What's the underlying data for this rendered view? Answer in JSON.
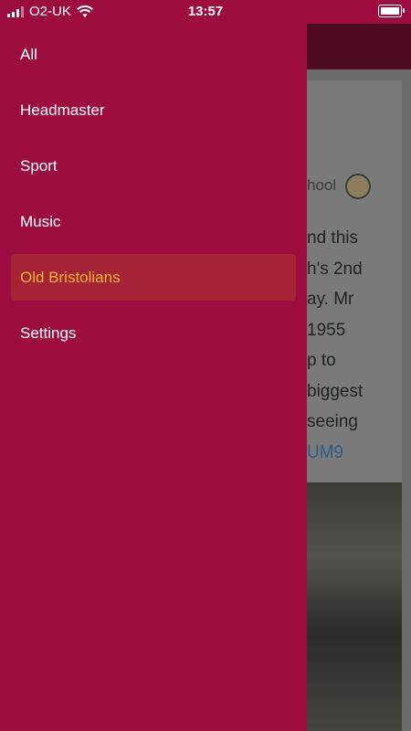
{
  "status_bar": {
    "carrier": "O2-UK",
    "time": "13:57"
  },
  "drawer": {
    "items": [
      {
        "label": "All",
        "active": false
      },
      {
        "label": "Headmaster",
        "active": false
      },
      {
        "label": "Sport",
        "active": false
      },
      {
        "label": "Music",
        "active": false
      },
      {
        "label": "Old Bristolians",
        "active": true
      },
      {
        "label": "Settings",
        "active": false
      }
    ]
  },
  "background_post": {
    "author_fragment": "hool",
    "text_lines": [
      "nd this",
      "h's 2nd",
      "ay. Mr",
      "1955",
      "p to",
      "biggest",
      "seeing"
    ],
    "link_fragment": "UM9"
  },
  "colors": {
    "drawer_bg": "#9c0c3e",
    "active_item_bg": "#a52335",
    "active_item_text": "#f7b733"
  }
}
